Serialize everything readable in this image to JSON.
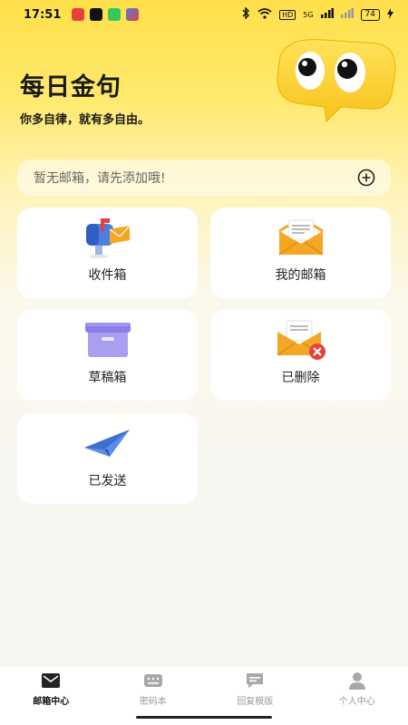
{
  "status_bar": {
    "time": "17:51",
    "battery": "74",
    "network_label": "HD",
    "signal_label": "5G"
  },
  "header": {
    "title": "每日金句",
    "subtitle": "你多自律，就有多自由。"
  },
  "notice": {
    "text": "暂无邮箱，请先添加哦!"
  },
  "cards": [
    {
      "label": "收件箱",
      "icon": "mailbox-icon"
    },
    {
      "label": "我的邮箱",
      "icon": "envelope-letter-icon"
    },
    {
      "label": "草稿箱",
      "icon": "archive-box-icon"
    },
    {
      "label": "已删除",
      "icon": "envelope-delete-icon"
    },
    {
      "label": "已发送",
      "icon": "paper-plane-icon"
    }
  ],
  "tabs": [
    {
      "label": "邮箱中心",
      "icon": "mail-center-icon",
      "active": true
    },
    {
      "label": "密码本",
      "icon": "password-book-icon",
      "active": false
    },
    {
      "label": "回复模版",
      "icon": "reply-template-icon",
      "active": false
    },
    {
      "label": "个人中心",
      "icon": "profile-icon",
      "active": false
    }
  ],
  "colors": {
    "accent_yellow": "#ffe04a",
    "card_bg": "#ffffff",
    "mail_blue": "#4a7fe0",
    "envelope_orange": "#f5a623",
    "delete_red": "#e8413c",
    "box_purple": "#8a7fe6"
  }
}
